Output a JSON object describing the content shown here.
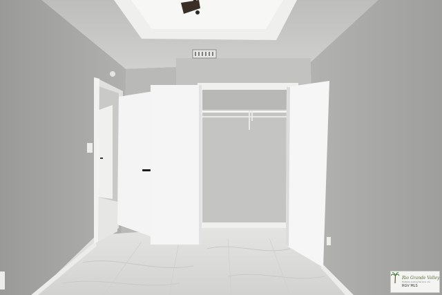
{
  "watermark": {
    "brand": "Rio Grande Valley",
    "subtitle": "Multiple Listing Service, Inc.",
    "mls": "RGV MLS"
  },
  "colors": {
    "wall_left": "#a6a6a4",
    "wall_right": "#a9a9a7",
    "ceiling": "#cfcfcd",
    "door": "#f2f2f2",
    "floor": "#dcdcda",
    "closet_interior": "#c4c4c2"
  },
  "icons": [
    "ceiling-fan-icon",
    "air-vent-icon",
    "door-handle-icon",
    "palm-tree-icon"
  ]
}
